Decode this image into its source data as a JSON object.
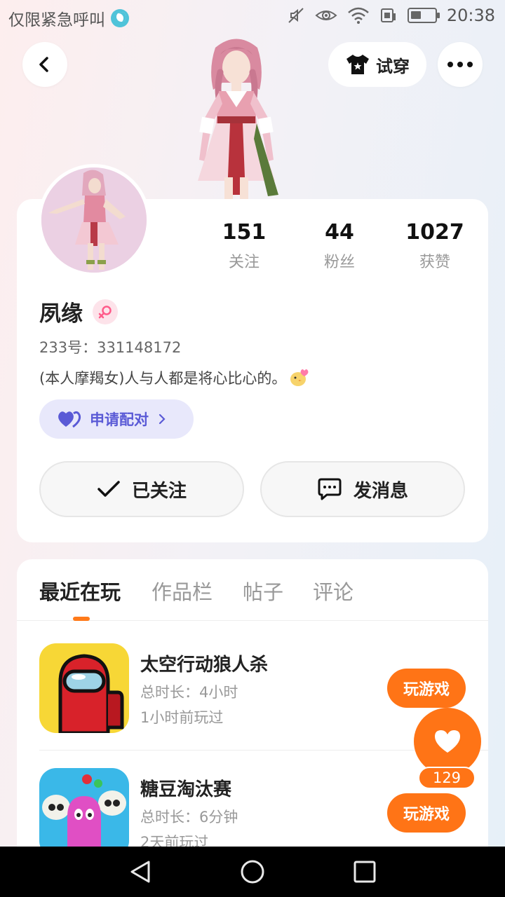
{
  "status_bar": {
    "left_text": "仅限紧急呼叫",
    "time": "20:38"
  },
  "header": {
    "tryon_label": "试穿"
  },
  "profile": {
    "name": "夙缘",
    "uid": "233号：331148172",
    "bio": "(本人摩羯女)人与人都是将心比心的。",
    "pair_label": "申请配对",
    "stats": [
      {
        "value": "151",
        "label": "关注"
      },
      {
        "value": "44",
        "label": "粉丝"
      },
      {
        "value": "1027",
        "label": "获赞"
      }
    ],
    "follow_label": "已关注",
    "message_label": "发消息"
  },
  "tabs": [
    "最近在玩",
    "作品栏",
    "帖子",
    "评论"
  ],
  "games": [
    {
      "title": "太空行动狼人杀",
      "duration": "总时长：4小时",
      "last_played": "1小时前玩过",
      "button": "玩游戏"
    },
    {
      "title": "糖豆淘汰赛",
      "duration": "总时长：6分钟",
      "last_played": "2天前玩过",
      "button": "玩游戏"
    }
  ],
  "like": {
    "count": "129"
  },
  "colors": {
    "accent": "#ff7416",
    "pair": "#5a5ad6"
  }
}
